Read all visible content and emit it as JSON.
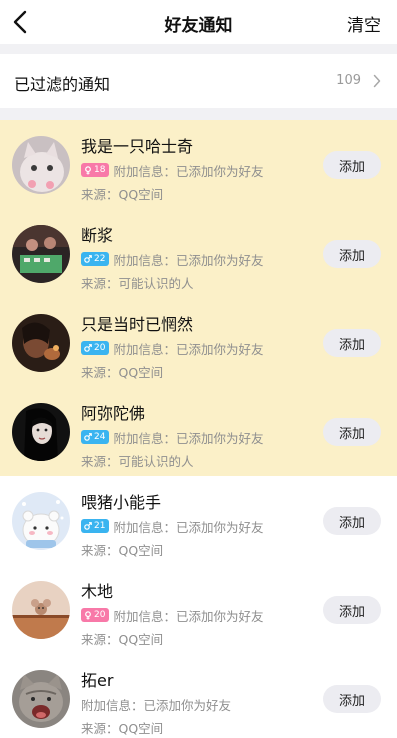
{
  "header": {
    "title": "好友通知",
    "clear_label": "清空"
  },
  "filtered": {
    "label": "已过滤的通知",
    "count": "109"
  },
  "colors": {
    "highlight": "#fbf0c8",
    "badge_female": "#f879a8",
    "badge_male": "#3ab4f0",
    "button_bg": "#ececf1"
  },
  "requests": [
    {
      "name": "我是一只哈士奇",
      "badge_icon": "female-icon",
      "age": "18",
      "info": "附加信息：已添加你为好友",
      "source": "来源：QQ空间",
      "button": "添加",
      "highlighted": true
    },
    {
      "name": "断浆",
      "badge_icon": "male-icon",
      "age": "22",
      "info": "附加信息：已添加你为好友",
      "source": "来源：可能认识的人",
      "button": "添加",
      "highlighted": true
    },
    {
      "name": "只是当时已惘然",
      "badge_icon": "male-icon",
      "age": "20",
      "info": "附加信息：已添加你为好友",
      "source": "来源：QQ空间",
      "button": "添加",
      "highlighted": true
    },
    {
      "name": "阿弥陀佛",
      "badge_icon": "male-icon",
      "age": "24",
      "info": "附加信息：已添加你为好友",
      "source": "来源：可能认识的人",
      "button": "添加",
      "highlighted": true
    },
    {
      "name": "喂猪小能手",
      "badge_icon": "male-icon",
      "age": "21",
      "info": "附加信息：已添加你为好友",
      "source": "来源：QQ空间",
      "button": "添加",
      "highlighted": false
    },
    {
      "name": "木地",
      "badge_icon": "female-icon",
      "age": "20",
      "info": "附加信息：已添加你为好友",
      "source": "来源：QQ空间",
      "button": "添加",
      "highlighted": false
    },
    {
      "name": "拓er",
      "info": "附加信息：已添加你为好友",
      "source": "来源：QQ空间",
      "button": "添加",
      "highlighted": false
    }
  ]
}
